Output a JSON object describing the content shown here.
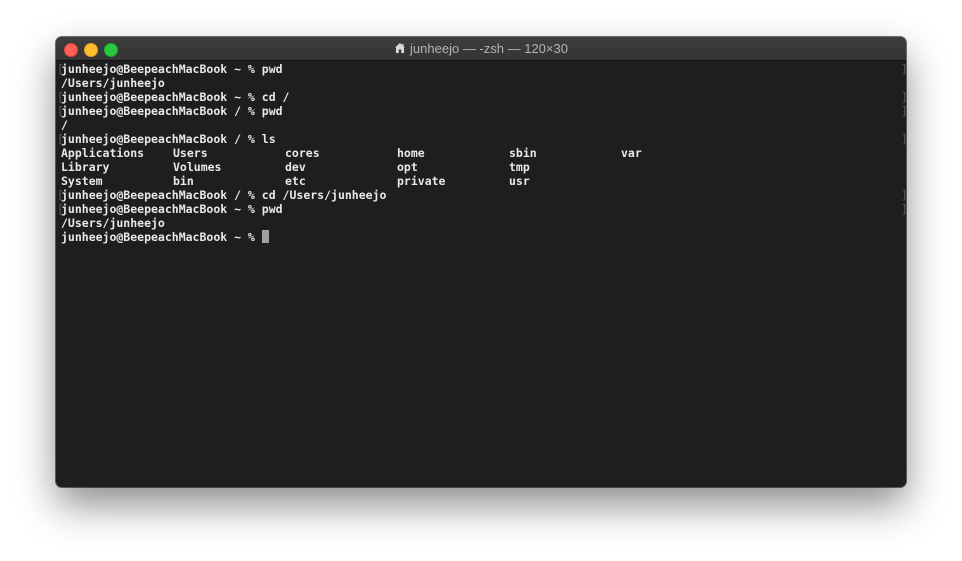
{
  "window": {
    "title": "junheejo — -zsh — 120×30",
    "title_icon": "home-icon"
  },
  "terminal": {
    "line1": "junheejo@BeepeachMacBook ~ % pwd",
    "line2": "/Users/junheejo",
    "line3": "junheejo@BeepeachMacBook ~ % cd /",
    "line4": "junheejo@BeepeachMacBook / % pwd",
    "line5": "/",
    "line6": "junheejo@BeepeachMacBook / % ls",
    "ls": [
      [
        "Applications",
        "Users",
        "cores",
        "home",
        "sbin",
        "var"
      ],
      [
        "Library",
        "Volumes",
        "dev",
        "opt",
        "tmp"
      ],
      [
        "System",
        "bin",
        "etc",
        "private",
        "usr"
      ]
    ],
    "line7": "junheejo@BeepeachMacBook / % cd /Users/junheejo",
    "line8": "junheejo@BeepeachMacBook ~ % pwd",
    "line9": "/Users/junheejo",
    "prompt": "junheejo@BeepeachMacBook ~ % "
  },
  "colors": {
    "background": "#1e1e1e",
    "text": "#e8e8e8",
    "close": "#fe5f57",
    "minimize": "#febc2e",
    "maximize": "#28c840"
  }
}
